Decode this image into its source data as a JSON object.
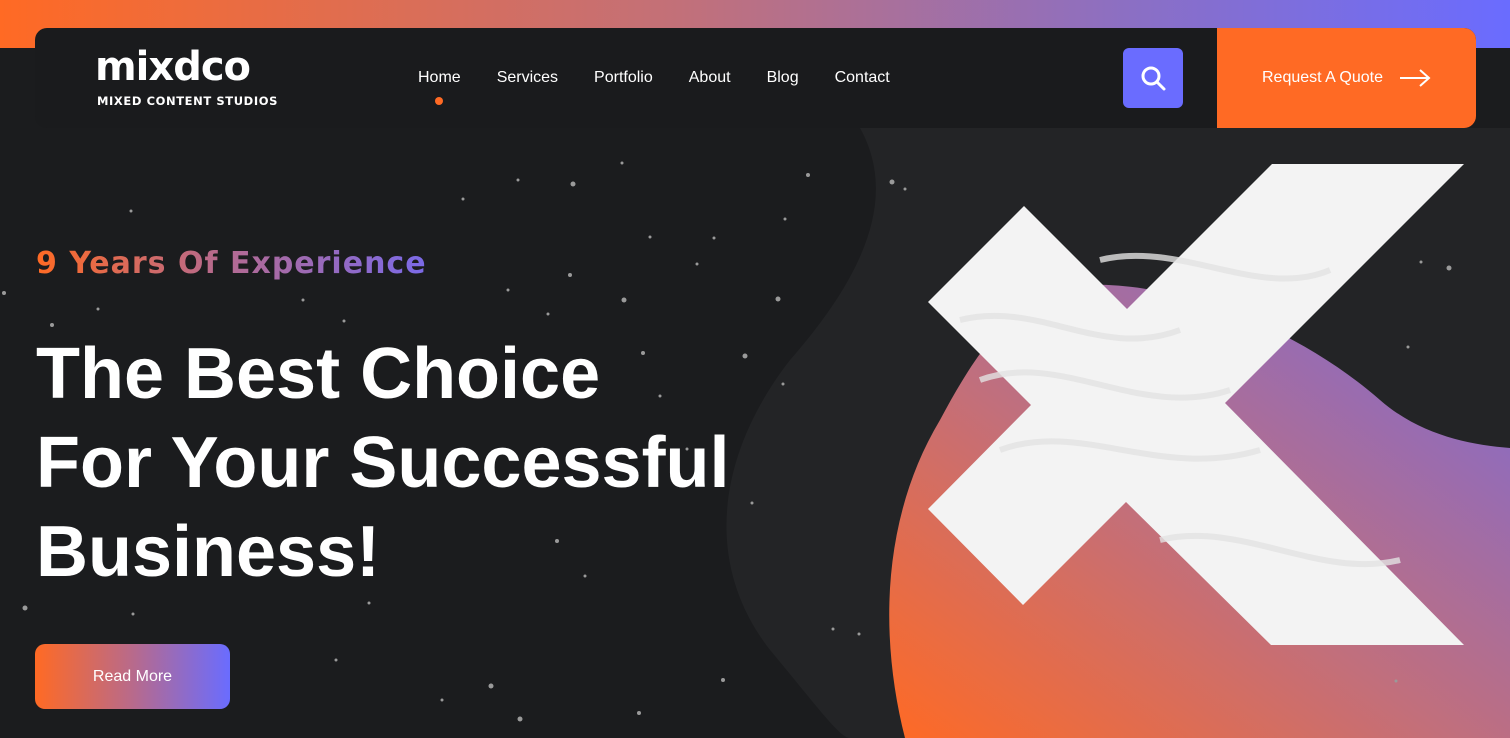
{
  "brand": {
    "logo_text": "mixdco",
    "tagline": "MIXED CONTENT STUDIOS"
  },
  "nav": {
    "items": [
      {
        "label": "Home",
        "active": true
      },
      {
        "label": "Services"
      },
      {
        "label": "Portfolio"
      },
      {
        "label": "About"
      },
      {
        "label": "Blog"
      },
      {
        "label": "Contact"
      }
    ],
    "search_icon": "search-icon",
    "quote_label": "Request A Quote",
    "quote_icon": "arrow-right-icon"
  },
  "hero": {
    "kicker": "9 Years Of Experience",
    "headline_lines": [
      "The Best Choice",
      "For Your Successful",
      "Business!"
    ],
    "cta_label": "Read More"
  },
  "colors": {
    "accent_orange": "#ff6a24",
    "accent_purple": "#6a6cff",
    "background": "#1b1c1e"
  }
}
